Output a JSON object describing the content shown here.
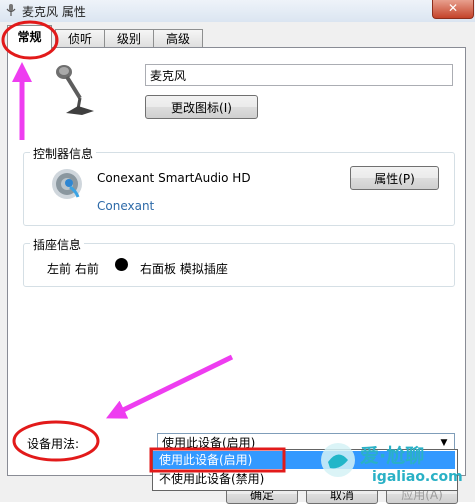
{
  "window": {
    "title": "麦克风 属性",
    "close_symbol": "✕"
  },
  "tabs": [
    {
      "label": "常规",
      "active": true
    },
    {
      "label": "侦听",
      "active": false
    },
    {
      "label": "级别",
      "active": false
    },
    {
      "label": "高级",
      "active": false
    }
  ],
  "device": {
    "name": "麦克风",
    "change_icon_label": "更改图标(I)"
  },
  "controller": {
    "group_title": "控制器信息",
    "name": "Conexant SmartAudio HD",
    "vendor": "Conexant",
    "properties_label": "属性(P)"
  },
  "jack": {
    "group_title": "插座信息",
    "description": "左前 右前",
    "location": "右面板 模拟插座"
  },
  "usage": {
    "label": "设备用法:",
    "selected": "使用此设备(启用)",
    "options": [
      "使用此设备(启用)",
      "不使用此设备(禁用)"
    ]
  },
  "footer": {
    "ok": "确定",
    "cancel": "取消",
    "apply": "应用(A)"
  },
  "watermark": {
    "brand": "爱·尬聊",
    "url": "igaliao.com"
  },
  "annotation_color": "#e21a1a",
  "arrow_color": "#ee3df0",
  "accent_color": "#3399ff"
}
